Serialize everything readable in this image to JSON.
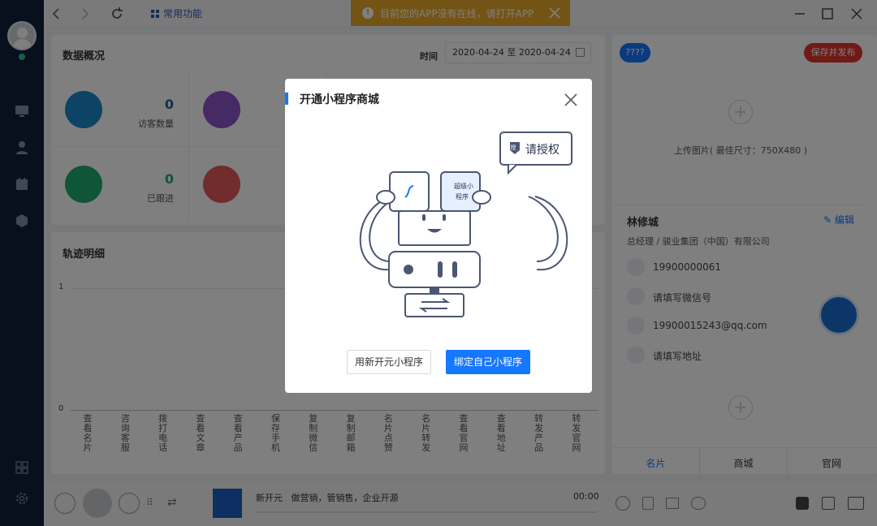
{
  "topbar": {
    "fav_label": "常用功能",
    "warning": "目前您的APP没有在线，请打开APP"
  },
  "overview": {
    "title": "数据概况",
    "date_label": "时间",
    "date_range": "2020-04-24 至 2020-04-24",
    "stats": [
      {
        "value": "0",
        "label": "访客数量",
        "color": "#1b86c8"
      },
      {
        "value": "",
        "label": "",
        "color": "#8a55c9"
      },
      {
        "value": "0",
        "label": "已跟进",
        "color": "#1faa6e"
      },
      {
        "value": "",
        "label": "",
        "color": "#e25858"
      }
    ]
  },
  "track": {
    "title": "轨迹明细",
    "y_top": "1",
    "y_bottom": "0",
    "x_labels": [
      "查看名片",
      "咨询客服",
      "拨打电话",
      "查看文章",
      "查看产品",
      "保存手机",
      "复制微信",
      "复制邮箱",
      "名片点赞",
      "名片转发",
      "查看官网",
      "查看地址",
      "转发产品",
      "转发官网"
    ]
  },
  "right": {
    "pill_left": "????",
    "publish": "保存并发布",
    "upload": "上传图片( 最佳尺寸：750X480 )",
    "name": "林修城",
    "edit": "编辑",
    "position": "总经理 / 骏业集团（中国）有限公司",
    "phone": "19900000061",
    "wechat": "请填写微信号",
    "email": "19900015243@qq.com",
    "address": "请填写地址",
    "tabs": [
      "名片",
      "商城",
      "官网"
    ]
  },
  "player": {
    "text": "新开元   做营销，管销售，企业开源",
    "time": "00:00"
  },
  "modal": {
    "title": "开通小程序商城",
    "bubble": "请授权",
    "bubble_badge": "授",
    "piece_text": "超级小程序",
    "btn_new": "用新开元小程序",
    "btn_bind": "绑定自己小程序"
  }
}
